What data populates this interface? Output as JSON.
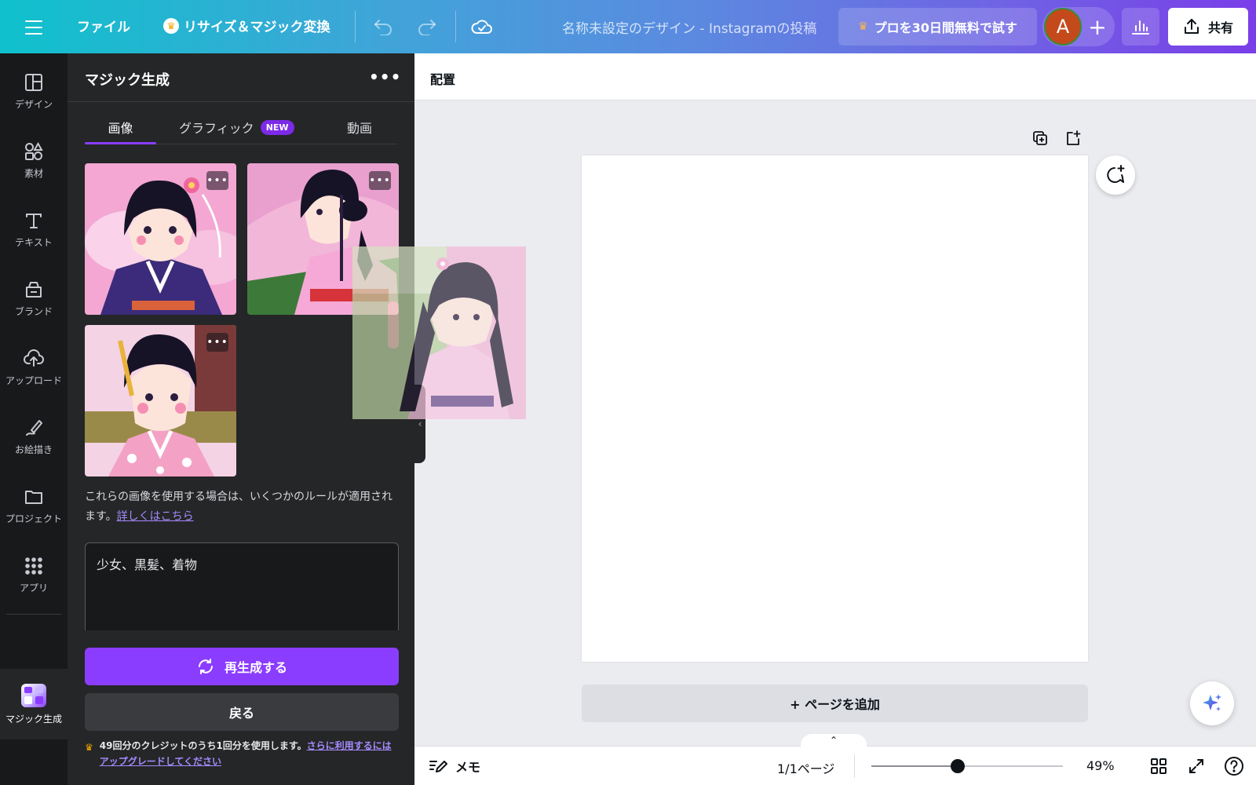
{
  "topbar": {
    "file_label": "ファイル",
    "resize_label": "リサイズ＆マジック変換",
    "design_title": "名称未設定のデザイン - Instagramの投稿",
    "pro_label": "プロを30日間無料で試す",
    "avatar_initial": "A",
    "share_label": "共有"
  },
  "rail": {
    "items": [
      {
        "label": "デザイン",
        "icon": "layout-icon"
      },
      {
        "label": "素材",
        "icon": "shapes-icon"
      },
      {
        "label": "テキスト",
        "icon": "text-icon"
      },
      {
        "label": "ブランド",
        "icon": "brand-icon"
      },
      {
        "label": "アップロード",
        "icon": "cloud-upload-icon"
      },
      {
        "label": "お絵描き",
        "icon": "draw-icon"
      },
      {
        "label": "プロジェクト",
        "icon": "folder-icon"
      },
      {
        "label": "アプリ",
        "icon": "apps-grid-icon"
      }
    ],
    "active_label": "マジック生成"
  },
  "panel": {
    "title": "マジック生成",
    "tabs": [
      {
        "label": "画像",
        "active": true
      },
      {
        "label": "グラフィック",
        "badge": "NEW"
      },
      {
        "label": "動画"
      }
    ],
    "notice_text": "これらの画像を使用する場合は、いくつかのルールが適用されます。",
    "notice_link": "詳しくはこちら",
    "prompt_value": "少女、黒髪、着物",
    "regenerate_label": "再生成する",
    "back_label": "戻る",
    "credits_text": "49回分のクレジットのうち1回分を使用します。",
    "credits_link": "さらに利用するにはアップグレードしてください"
  },
  "canvas": {
    "arrange_label": "配置",
    "add_page_label": "+ ページを追加"
  },
  "bottombar": {
    "notes_label": "メモ",
    "page_indicator": "1/1ページ",
    "zoom_label": "49%",
    "zoom_fraction": 0.45
  },
  "colors": {
    "accent": "#8b3dff",
    "topbar_gradient_start": "#0fc1cc",
    "topbar_gradient_end": "#7a3ee8",
    "panel_bg": "#252627",
    "rail_bg": "#18191b"
  }
}
